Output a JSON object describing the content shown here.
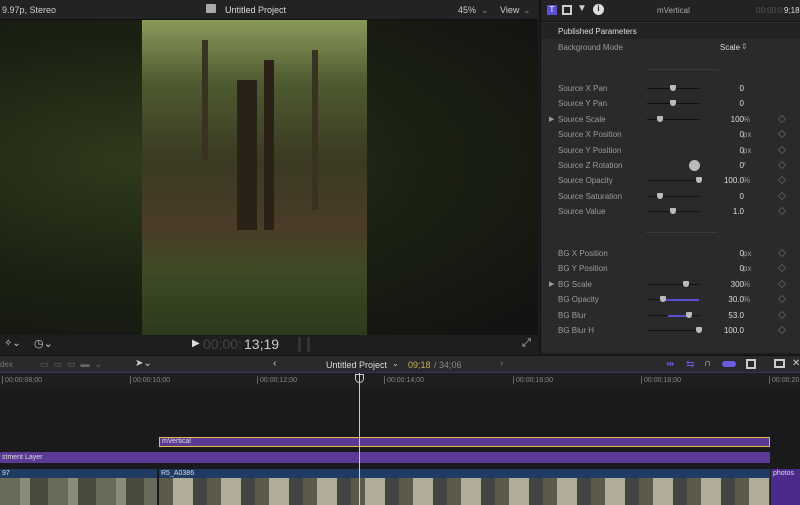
{
  "viewer": {
    "format": "9.97p, Stereo",
    "title": "Untitled Project",
    "zoom": "45%",
    "view": "View",
    "timecode_dim": "00:00:",
    "timecode": "13;19"
  },
  "inspector": {
    "clip_name": "mVertical",
    "timecode_dim": "00:00:0",
    "timecode": "9;18",
    "section": "Published Parameters",
    "background_mode": {
      "label": "Background Mode",
      "value": "Scale"
    },
    "params": [
      {
        "label": "Source X Pan",
        "value": "0",
        "unit": "",
        "slider": 0.5,
        "kf": false
      },
      {
        "label": "Source Y Pan",
        "value": "0",
        "unit": "",
        "slider": 0.5,
        "kf": false
      },
      {
        "label": "Source Scale",
        "value": "100",
        "unit": "%",
        "slider": 0.25,
        "kf": true,
        "expand": true
      },
      {
        "label": "Source X Position",
        "value": "0",
        "unit": "px",
        "kf": true
      },
      {
        "label": "Source Y Position",
        "value": "0",
        "unit": "px",
        "kf": true
      },
      {
        "label": "Source Z Rotation",
        "value": "0",
        "unit": "°",
        "dial": true,
        "kf": true
      },
      {
        "label": "Source Opacity",
        "value": "100.0",
        "unit": "%",
        "slider": 1.0,
        "kf": true
      },
      {
        "label": "Source Saturation",
        "value": "0",
        "unit": "",
        "slider": 0.25,
        "kf": true
      },
      {
        "label": "Source Value",
        "value": "1.0",
        "unit": "",
        "slider": 0.5,
        "kf": true
      }
    ],
    "bg_params": [
      {
        "label": "BG X Position",
        "value": "0",
        "unit": "px",
        "kf": true
      },
      {
        "label": "BG Y Position",
        "value": "0",
        "unit": "px",
        "kf": true
      },
      {
        "label": "BG Scale",
        "value": "300",
        "unit": "%",
        "slider": 0.75,
        "kf": true,
        "expand": true
      },
      {
        "label": "BG Opacity",
        "value": "30.0",
        "unit": "%",
        "slider": 0.3,
        "fill": "right",
        "kf": true
      },
      {
        "label": "BG Blur",
        "value": "53.0",
        "unit": "",
        "slider": 0.8,
        "fill": "left",
        "kf": true
      },
      {
        "label": "BG Blur H",
        "value": "100.0",
        "unit": "",
        "slider": 1.0,
        "kf": true
      }
    ]
  },
  "timeline": {
    "index_label": "dex",
    "project": "Untitled Project",
    "position": "09;18",
    "duration": "/ 34;06",
    "ruler": [
      "00:00:08;00",
      "00:00:10;00",
      "00:00:12;00",
      "00:00:14;00",
      "00:00:16;00",
      "00:00:18;00",
      "00:00:20"
    ],
    "clips": {
      "title": "mVertical",
      "adjustment": "stment Layer",
      "video1": "97",
      "video2": "R5_A0386",
      "video3": "photos"
    }
  },
  "colors": {
    "accent": "#5a4fd0",
    "clip_purple": "#5b3a96",
    "selection": "#e8b84a",
    "video_blue": "#1f3a63"
  }
}
